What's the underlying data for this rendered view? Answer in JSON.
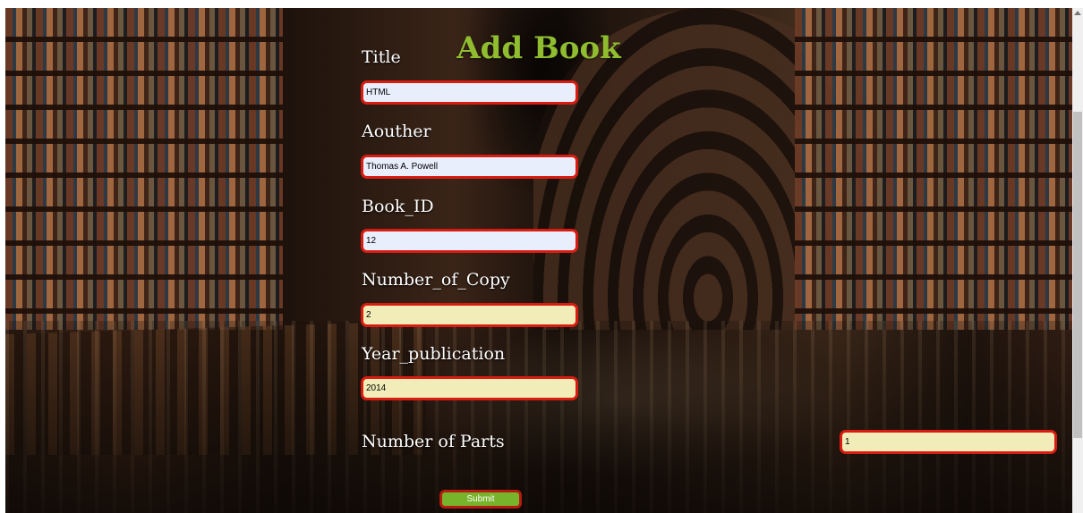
{
  "page": {
    "title": "Add Book"
  },
  "form": {
    "fields": [
      {
        "label": "Title",
        "value": "HTML"
      },
      {
        "label": "Aouther",
        "value": "Thomas A. Powell"
      },
      {
        "label": "Book_ID",
        "value": "12"
      },
      {
        "label": "Number_of_Copy",
        "value": "2"
      },
      {
        "label": "Year_publication",
        "value": "2014"
      },
      {
        "label": "Number of Parts",
        "value": "1"
      }
    ],
    "submit_label": "Submit"
  },
  "colors": {
    "title": "#8fbd2f",
    "input_border": "#d91c12",
    "input_blue": "#e9eefc",
    "input_yellow": "#f2edb8",
    "submit_bg": "#78b42b"
  },
  "icons": {
    "scroll_up": "scroll-up-arrow-icon"
  }
}
